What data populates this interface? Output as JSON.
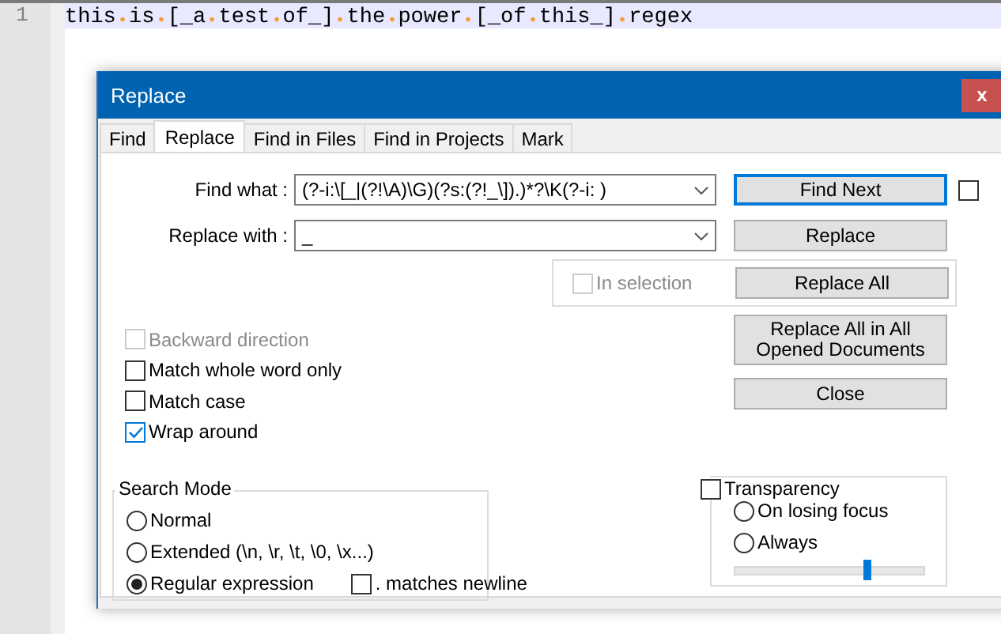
{
  "editor": {
    "lines": [
      {
        "number": "1",
        "text": "this is [_a test of_] the power [_of this_] regex",
        "current": true
      }
    ]
  },
  "dialog": {
    "title": "Replace",
    "close_label": "x",
    "tabs": [
      {
        "label": "Find",
        "selected": false
      },
      {
        "label": "Replace",
        "selected": true
      },
      {
        "label": "Find in Files",
        "selected": false
      },
      {
        "label": "Find in Projects",
        "selected": false
      },
      {
        "label": "Mark",
        "selected": false
      }
    ],
    "fields": [
      {
        "label": "Find what :",
        "value": "(?-i:\\[_|(?!\\A)\\G)(?s:(?!_\\]).)*?\\K(?-i: )"
      },
      {
        "label": "Replace with :",
        "value": "_"
      }
    ],
    "side_checkbox": {
      "checked": false
    },
    "buttons": [
      {
        "label": "Find Next",
        "focused": true
      },
      {
        "label": "Replace",
        "focused": false
      },
      {
        "label": "Replace All",
        "focused": false
      },
      {
        "label": "Replace All in All Opened Documents",
        "focused": false
      },
      {
        "label": "Close",
        "focused": false
      }
    ],
    "in_selection": {
      "label": "In selection",
      "checked": false,
      "disabled": true
    },
    "options": [
      {
        "label": "Backward direction",
        "checked": false,
        "disabled": true
      },
      {
        "label": "Match whole word only",
        "checked": false,
        "disabled": false
      },
      {
        "label": "Match case",
        "checked": false,
        "disabled": false
      },
      {
        "label": "Wrap around",
        "checked": true,
        "disabled": false
      }
    ],
    "search_mode": {
      "title": "Search Mode",
      "options": [
        {
          "label": "Normal",
          "selected": false
        },
        {
          "label": "Extended (\\n, \\r, \\t, \\0, \\x...)",
          "selected": false
        },
        {
          "label": "Regular expression",
          "selected": true
        }
      ],
      "dot_matches_newline": {
        "label": ". matches newline",
        "checked": false
      }
    },
    "transparency": {
      "label": "Transparency",
      "checked": false,
      "options": [
        {
          "label": "On losing focus",
          "selected": false
        },
        {
          "label": "Always",
          "selected": false
        }
      ],
      "slider": {
        "level": 0.7
      }
    }
  }
}
